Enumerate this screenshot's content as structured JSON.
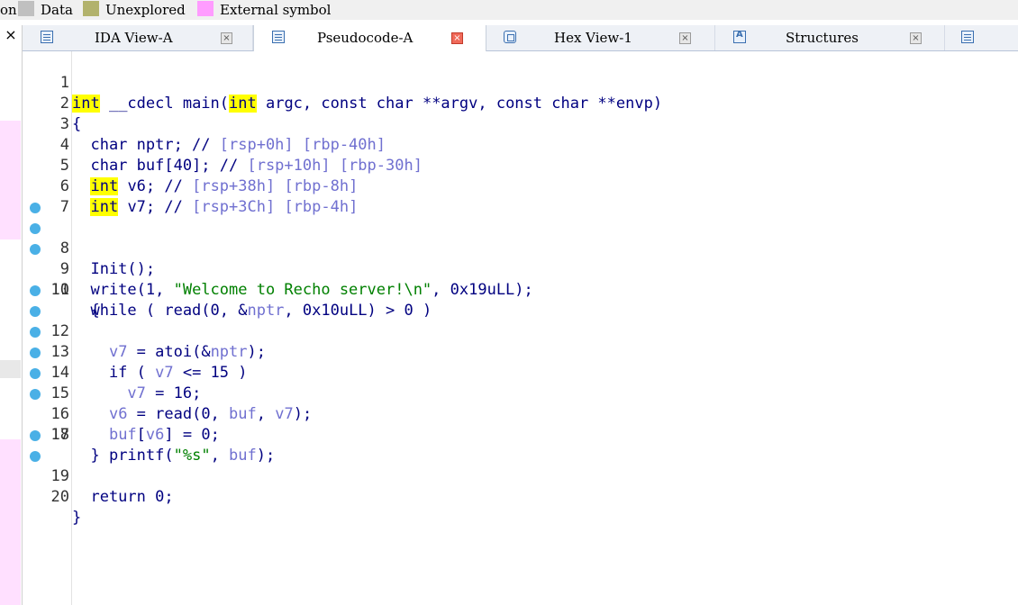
{
  "legend": {
    "cut_label": "on",
    "items": [
      {
        "label": "Data",
        "color": "#c0c0c0"
      },
      {
        "label": "Unexplored",
        "color": "#b2b26c"
      },
      {
        "label": "External symbol",
        "color": "#ff9cff"
      }
    ]
  },
  "sidebar": {
    "close_glyph": "×"
  },
  "tabs": [
    {
      "label": "IDA View-A",
      "icon": "ida-view-icon",
      "active": false
    },
    {
      "label": "Pseudocode-A",
      "icon": "pseudocode-icon",
      "active": true
    },
    {
      "label": "Hex View-1",
      "icon": "hex-view-icon",
      "active": false
    },
    {
      "label": "Structures",
      "icon": "structures-icon",
      "active": false
    }
  ],
  "code": {
    "lines": [
      {
        "n": "1",
        "bp": false
      },
      {
        "n": "2",
        "bp": false
      },
      {
        "n": "3",
        "bp": false
      },
      {
        "n": "4",
        "bp": false
      },
      {
        "n": "5",
        "bp": false
      },
      {
        "n": "6",
        "bp": false
      },
      {
        "n": "7",
        "bp": false
      },
      {
        "n": "8",
        "bp": true
      },
      {
        "n": "9",
        "bp": true
      },
      {
        "n": "10",
        "bp": true
      },
      {
        "n": "11",
        "bp": false
      },
      {
        "n": "12",
        "bp": true
      },
      {
        "n": "13",
        "bp": true
      },
      {
        "n": "14",
        "bp": true
      },
      {
        "n": "15",
        "bp": true
      },
      {
        "n": "16",
        "bp": true
      },
      {
        "n": "17",
        "bp": true
      },
      {
        "n": "18",
        "bp": false
      },
      {
        "n": "19",
        "bp": true
      },
      {
        "n": "20",
        "bp": true
      }
    ],
    "l1": {
      "kw_int": "int",
      "a": " __cdecl main(",
      "kw_int2": "int",
      "b": " argc, const char **argv, const char **envp)"
    },
    "l2": "{",
    "l3": {
      "a": "  char nptr; // ",
      "c": "[rsp+0h] [rbp-40h]"
    },
    "l4": {
      "a": "  char buf[40]; // ",
      "c": "[rsp+10h] [rbp-30h]"
    },
    "l5": {
      "kw": "int",
      "a": " v6; // ",
      "c": "[rsp+38h] [rbp-8h]"
    },
    "l6": {
      "kw": "int",
      "a": " v7; // ",
      "c": "[rsp+3Ch] [rbp-4h]"
    },
    "l7": "",
    "l8": "  Init();",
    "l9": {
      "a": "  write(1, ",
      "s": "\"Welcome to Recho server!\\n\"",
      "b": ", 0x19uLL);"
    },
    "l10": {
      "a": "  while ( read(0, &",
      "v": "nptr",
      "b": ", 0x10uLL) > 0 )"
    },
    "l11": "  {",
    "l12": {
      "v": "v7",
      "a": " = atoi(&",
      "v2": "nptr",
      "b": ");"
    },
    "l13": {
      "a": "    if ( ",
      "v": "v7",
      "b": " <= 15 )"
    },
    "l14": {
      "v": "v7",
      "b": " = 16;"
    },
    "l15": {
      "v": "v6",
      "a": " = read(0, ",
      "v2": "buf",
      "m": ", ",
      "v3": "v7",
      "b": ");"
    },
    "l16": {
      "v": "buf",
      "a": "[",
      "v2": "v6",
      "b": "] = 0;"
    },
    "l17": {
      "a": "printf(",
      "s": "\"%s\"",
      "m": ", ",
      "v": "buf",
      "b": ");"
    },
    "l18": "  }",
    "l19": "  return 0;",
    "l20": "}"
  }
}
